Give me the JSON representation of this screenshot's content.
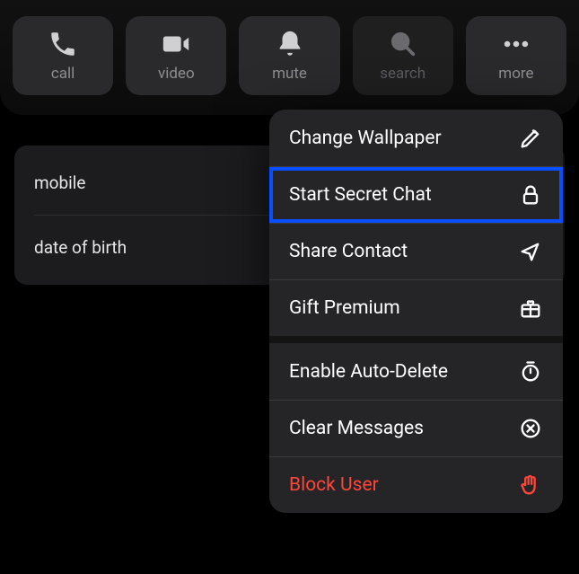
{
  "actions": {
    "call": {
      "label": "call"
    },
    "video": {
      "label": "video"
    },
    "mute": {
      "label": "mute"
    },
    "search": {
      "label": "search"
    },
    "more": {
      "label": "more"
    }
  },
  "info": {
    "mobile": {
      "label": "mobile"
    },
    "dob": {
      "label": "date of birth"
    }
  },
  "menu": {
    "change_wallpaper": {
      "label": "Change Wallpaper"
    },
    "start_secret_chat": {
      "label": "Start Secret Chat"
    },
    "share_contact": {
      "label": "Share Contact"
    },
    "gift_premium": {
      "label": "Gift Premium"
    },
    "enable_auto_delete": {
      "label": "Enable Auto-Delete"
    },
    "clear_messages": {
      "label": "Clear Messages"
    },
    "block_user": {
      "label": "Block User"
    }
  }
}
